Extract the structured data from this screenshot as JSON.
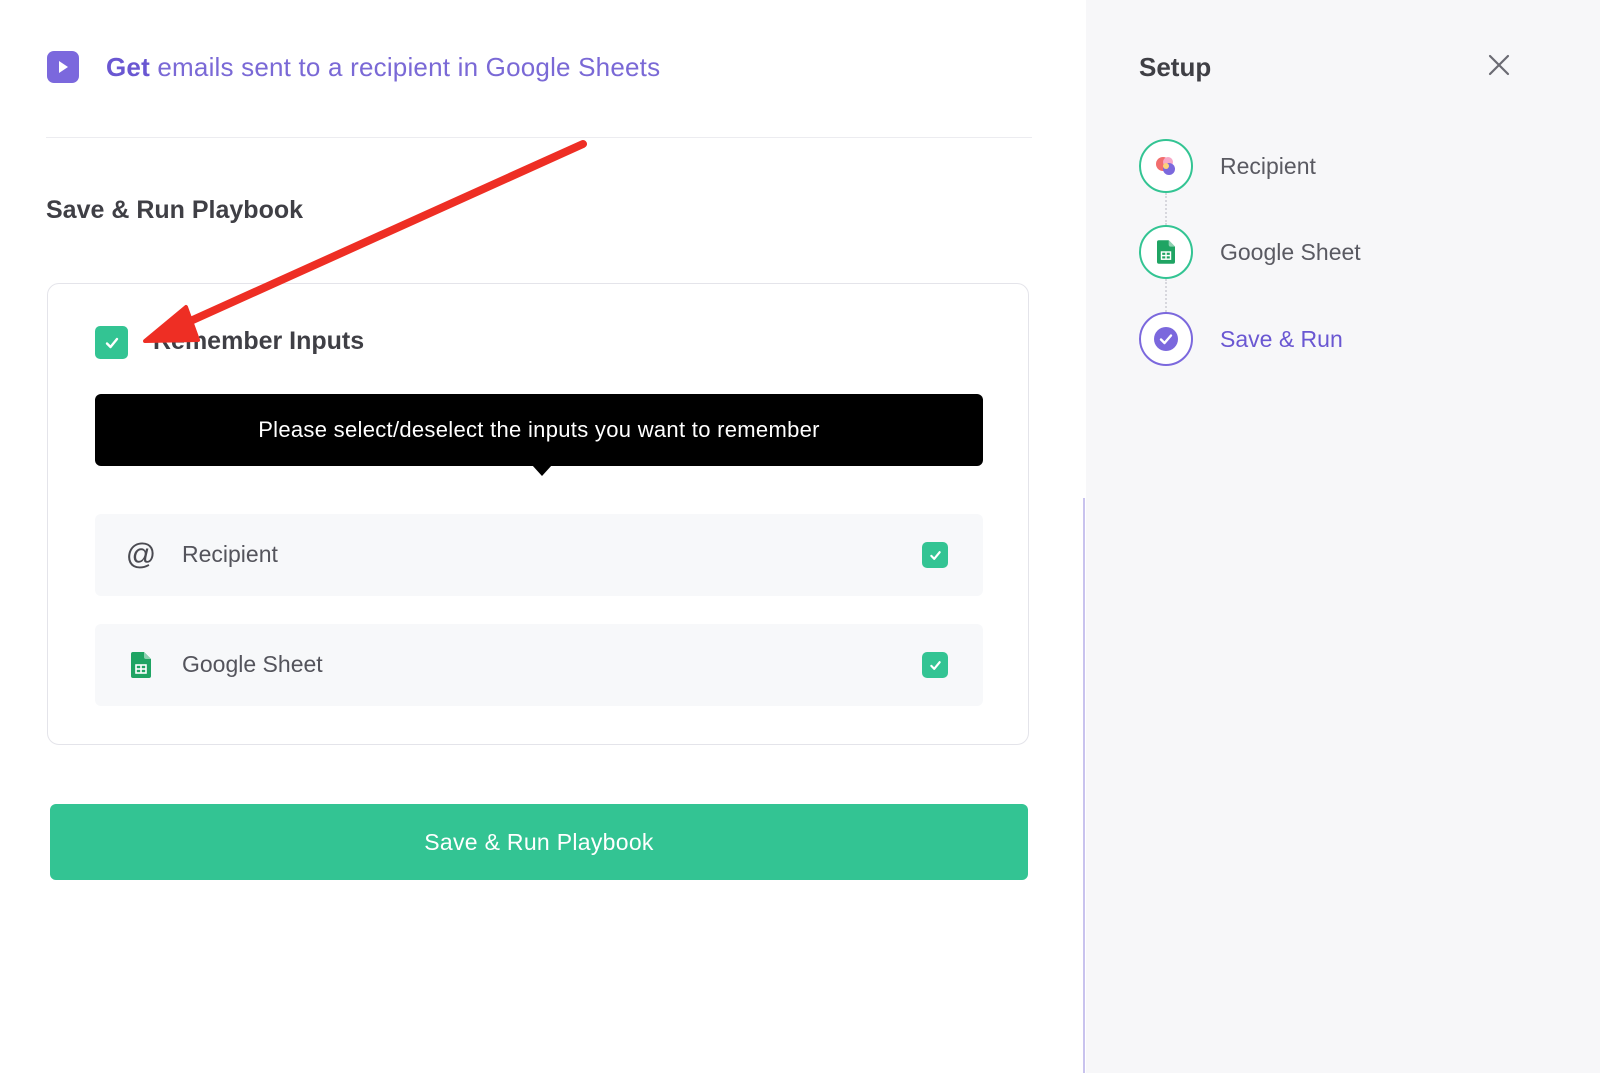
{
  "header": {
    "title_bold": "Get",
    "title_rest": "emails sent to a recipient in Google Sheets",
    "icon": "play-icon"
  },
  "main": {
    "section_title": "Save & Run Playbook",
    "remember_label": "Remember Inputs",
    "remember_checked": true,
    "tooltip": "Please select/deselect the inputs you want to remember",
    "inputs": [
      {
        "icon": "at-icon",
        "label": "Recipient",
        "checked": true
      },
      {
        "icon": "google-sheets-icon",
        "label": "Google Sheet",
        "checked": true
      }
    ],
    "primary_button": "Save & Run Playbook"
  },
  "sidebar": {
    "title": "Setup",
    "close_icon": "close-icon",
    "steps": [
      {
        "label": "Recipient",
        "icon": "recipient-app-icon",
        "state": "done"
      },
      {
        "label": "Google Sheet",
        "icon": "google-sheets-icon",
        "state": "done"
      },
      {
        "label": "Save & Run",
        "icon": "check-circle-icon",
        "state": "active"
      }
    ]
  },
  "colors": {
    "accent_purple": "#6a57d2",
    "success_green": "#33c493",
    "annotation_arrow": "#ee2e24"
  }
}
